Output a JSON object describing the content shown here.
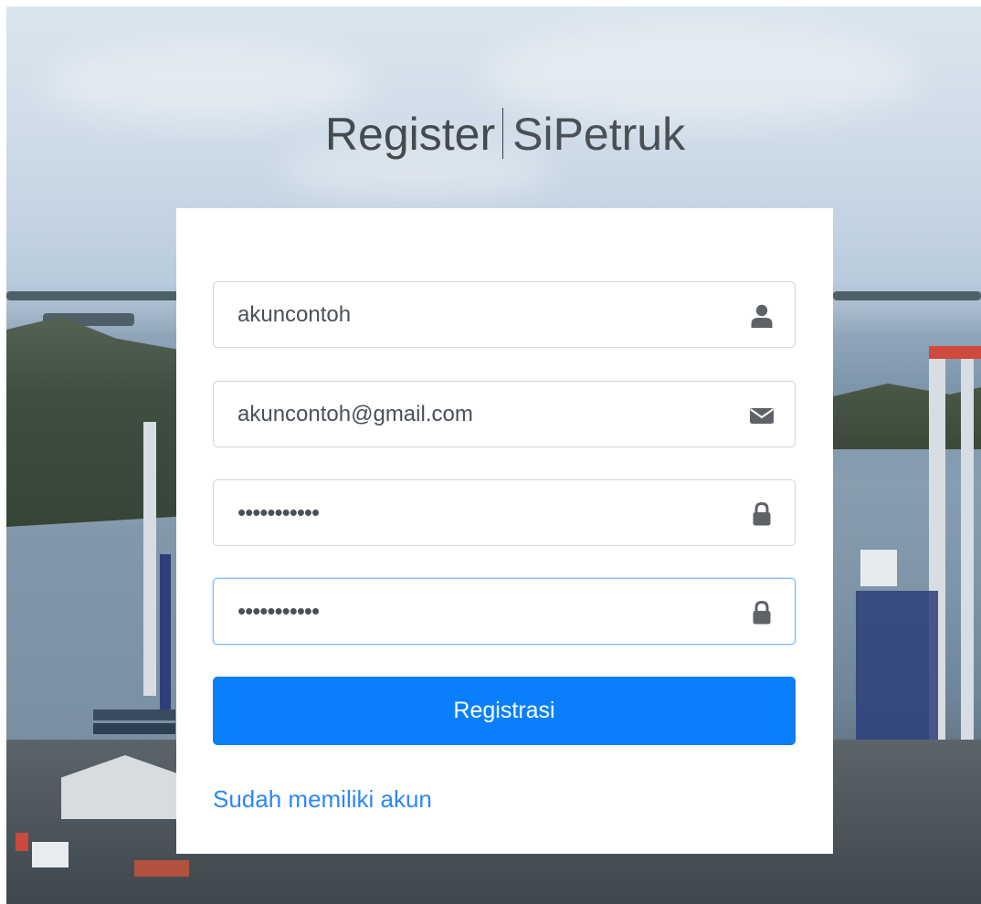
{
  "page": {
    "title_strong": "Register",
    "title_light": "SiPetruk"
  },
  "form": {
    "username": {
      "value": "akuncontoh",
      "icon": "user-icon"
    },
    "email": {
      "value": "akuncontoh@gmail.com",
      "icon": "envelope-icon"
    },
    "password": {
      "mask": "•••••••••••",
      "icon": "lock-icon"
    },
    "password_confirm": {
      "mask": "•••••••••••",
      "icon": "lock-icon"
    },
    "submit_label": "Registrasi",
    "login_link": "Sudah memiliki akun"
  },
  "colors": {
    "primary": "#0a7ffb",
    "link": "#2f86f6",
    "focus_border": "#80bdff",
    "icon": "#5f6368"
  }
}
